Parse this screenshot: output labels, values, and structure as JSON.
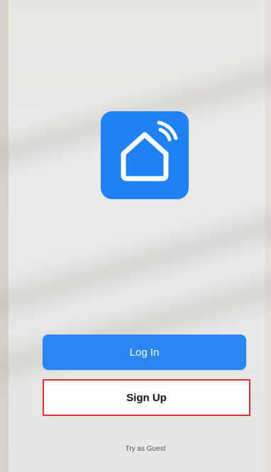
{
  "app": {
    "logo_icon": "smart-home-house-wifi-icon",
    "accent_color": "#1f83f5"
  },
  "actions": {
    "login_label": "Log In",
    "signup_label": "Sign Up",
    "guest_label": "Try as Guest"
  },
  "colors": {
    "login_button": "#2b86f3",
    "signup_highlight_border": "#d9323f"
  }
}
